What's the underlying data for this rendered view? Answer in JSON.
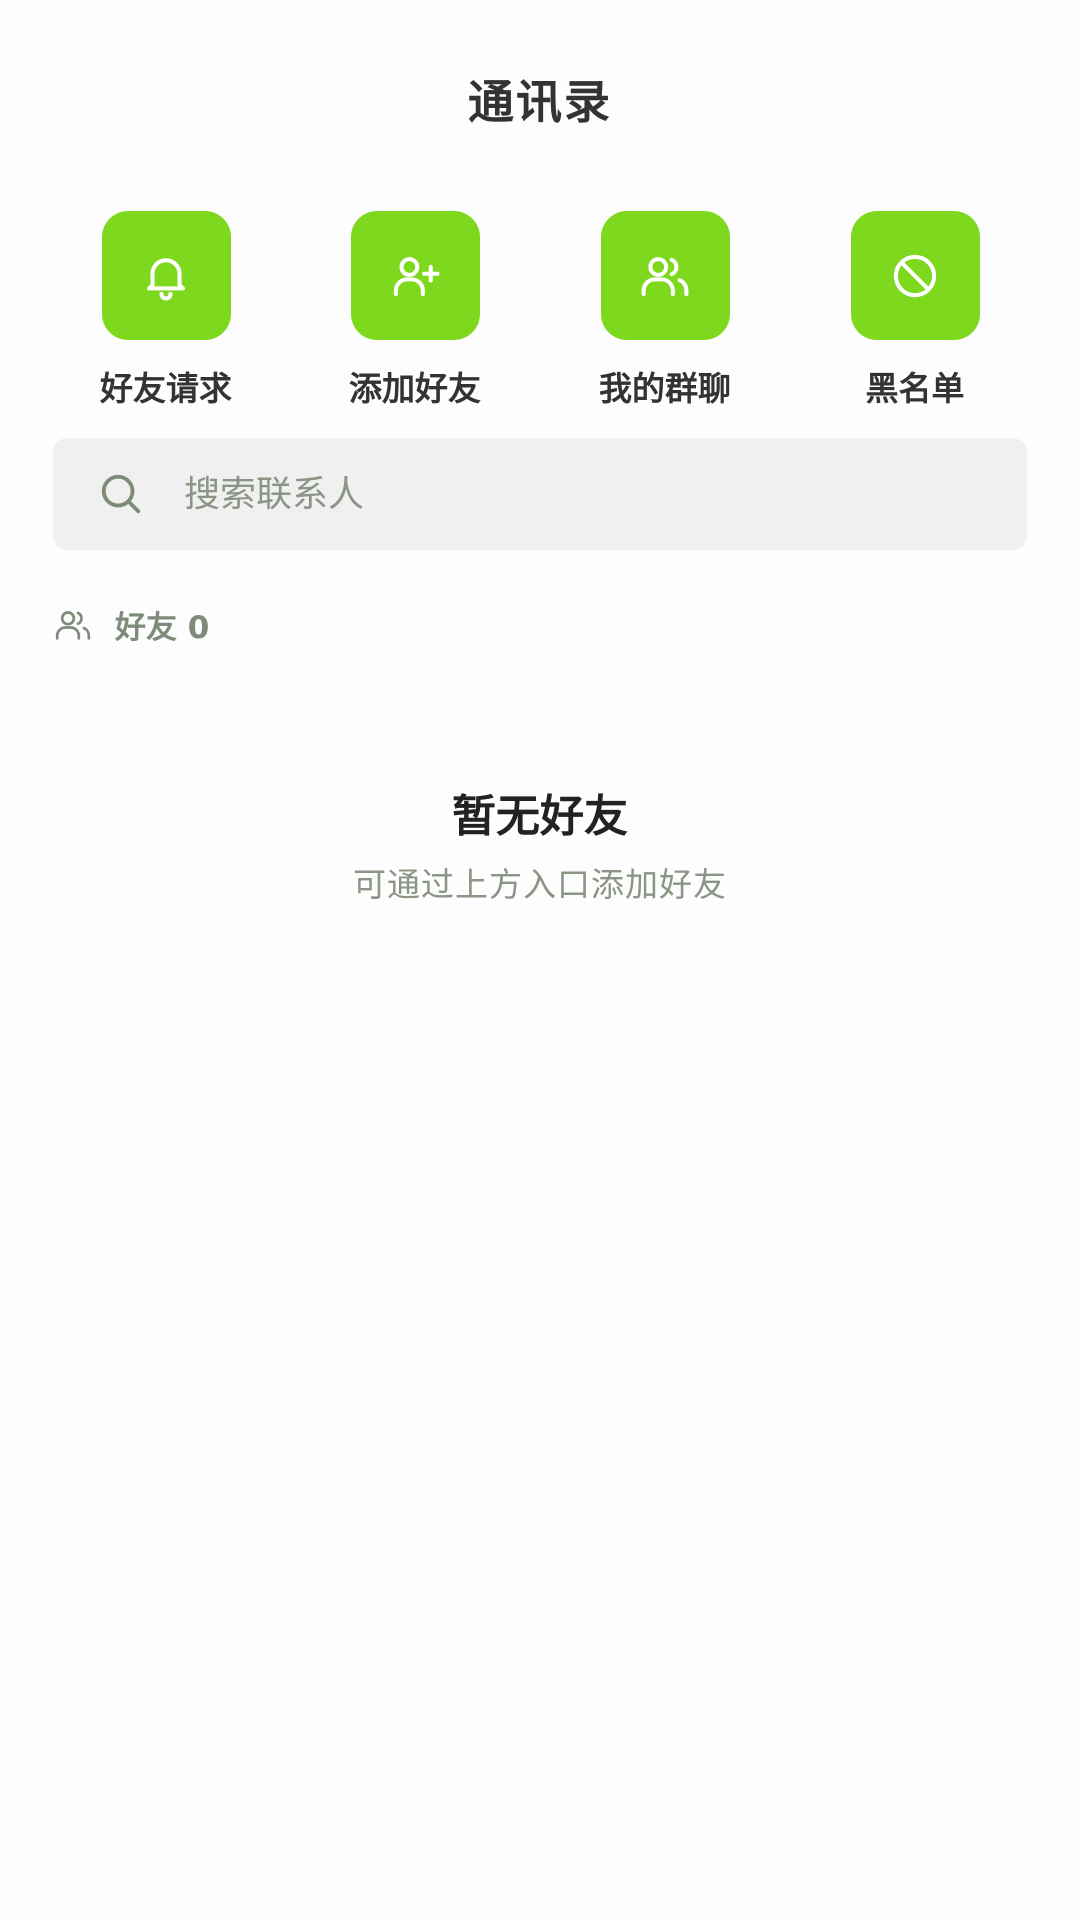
{
  "header": {
    "title": "通讯录"
  },
  "quick_actions": [
    {
      "label": "好友请求",
      "icon": "bell-icon"
    },
    {
      "label": "添加好友",
      "icon": "user-plus-icon"
    },
    {
      "label": "我的群聊",
      "icon": "users-icon"
    },
    {
      "label": "黑名单",
      "icon": "block-icon"
    }
  ],
  "search": {
    "placeholder": "搜索联系人",
    "value": ""
  },
  "friends_section": {
    "label": "好友 0"
  },
  "empty_state": {
    "title": "暂无好友",
    "subtitle": "可通过上方入口添加好友"
  },
  "colors": {
    "accent": "#7ed91e",
    "text_primary": "#333333",
    "text_muted": "#8a9585",
    "search_bg": "#f0f0f0"
  }
}
